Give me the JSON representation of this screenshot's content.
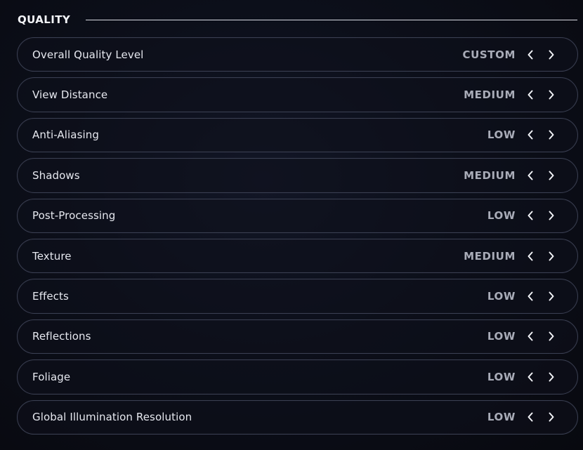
{
  "section": {
    "title": "QUALITY"
  },
  "settings": [
    {
      "label": "Overall Quality Level",
      "value": "CUSTOM"
    },
    {
      "label": "View Distance",
      "value": "MEDIUM"
    },
    {
      "label": "Anti-Aliasing",
      "value": "LOW"
    },
    {
      "label": "Shadows",
      "value": "MEDIUM"
    },
    {
      "label": "Post-Processing",
      "value": "LOW"
    },
    {
      "label": "Texture",
      "value": "MEDIUM"
    },
    {
      "label": "Effects",
      "value": "LOW"
    },
    {
      "label": "Reflections",
      "value": "LOW"
    },
    {
      "label": "Foliage",
      "value": "LOW"
    },
    {
      "label": "Global Illumination Resolution",
      "value": "LOW"
    }
  ],
  "icons": {
    "prev": "chevron-left-icon",
    "next": "chevron-right-icon"
  },
  "colors": {
    "label": "#e6e8ef",
    "value": "#a9acb8",
    "border": "#3a3f52",
    "background": "#0c0f1a"
  }
}
